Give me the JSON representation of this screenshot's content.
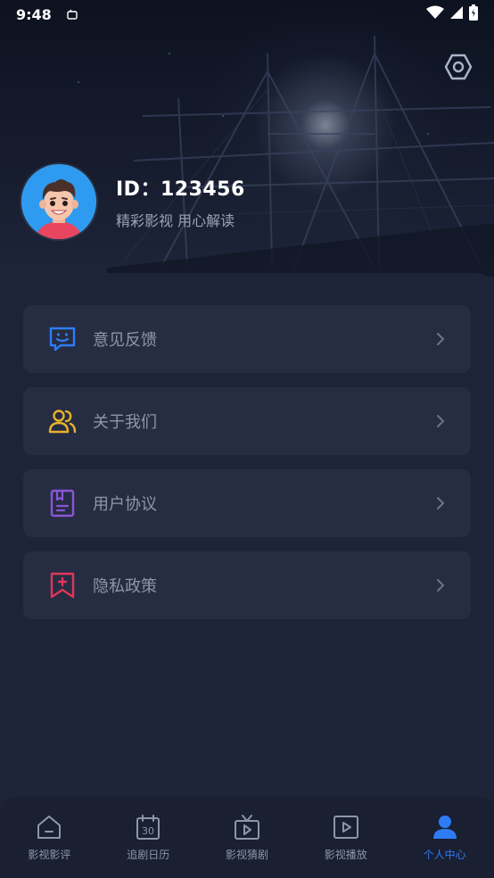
{
  "status_bar": {
    "time": "9:48"
  },
  "header": {
    "settings_icon": "gear-icon"
  },
  "profile": {
    "user_id": "ID：123456",
    "slogan": "精彩影视 用心解读"
  },
  "menu": [
    {
      "label": "意见反馈",
      "icon": "feedback-icon",
      "color": "#2f7df6"
    },
    {
      "label": "关于我们",
      "icon": "users-icon",
      "color": "#e8b22a"
    },
    {
      "label": "用户协议",
      "icon": "agreement-icon",
      "color": "#8a55d8"
    },
    {
      "label": "隐私政策",
      "icon": "privacy-icon",
      "color": "#e0365a"
    }
  ],
  "tabs": [
    {
      "label": "影视影评",
      "icon": "home-icon"
    },
    {
      "label": "追剧日历",
      "icon": "calendar-icon",
      "icon_text": "30"
    },
    {
      "label": "影视猜剧",
      "icon": "tv-icon"
    },
    {
      "label": "影视播放",
      "icon": "play-icon"
    },
    {
      "label": "个人中心",
      "icon": "user-icon",
      "active": true
    }
  ],
  "colors": {
    "accent": "#2d7cf6",
    "background": "#1c2134",
    "card": "#262c42"
  }
}
